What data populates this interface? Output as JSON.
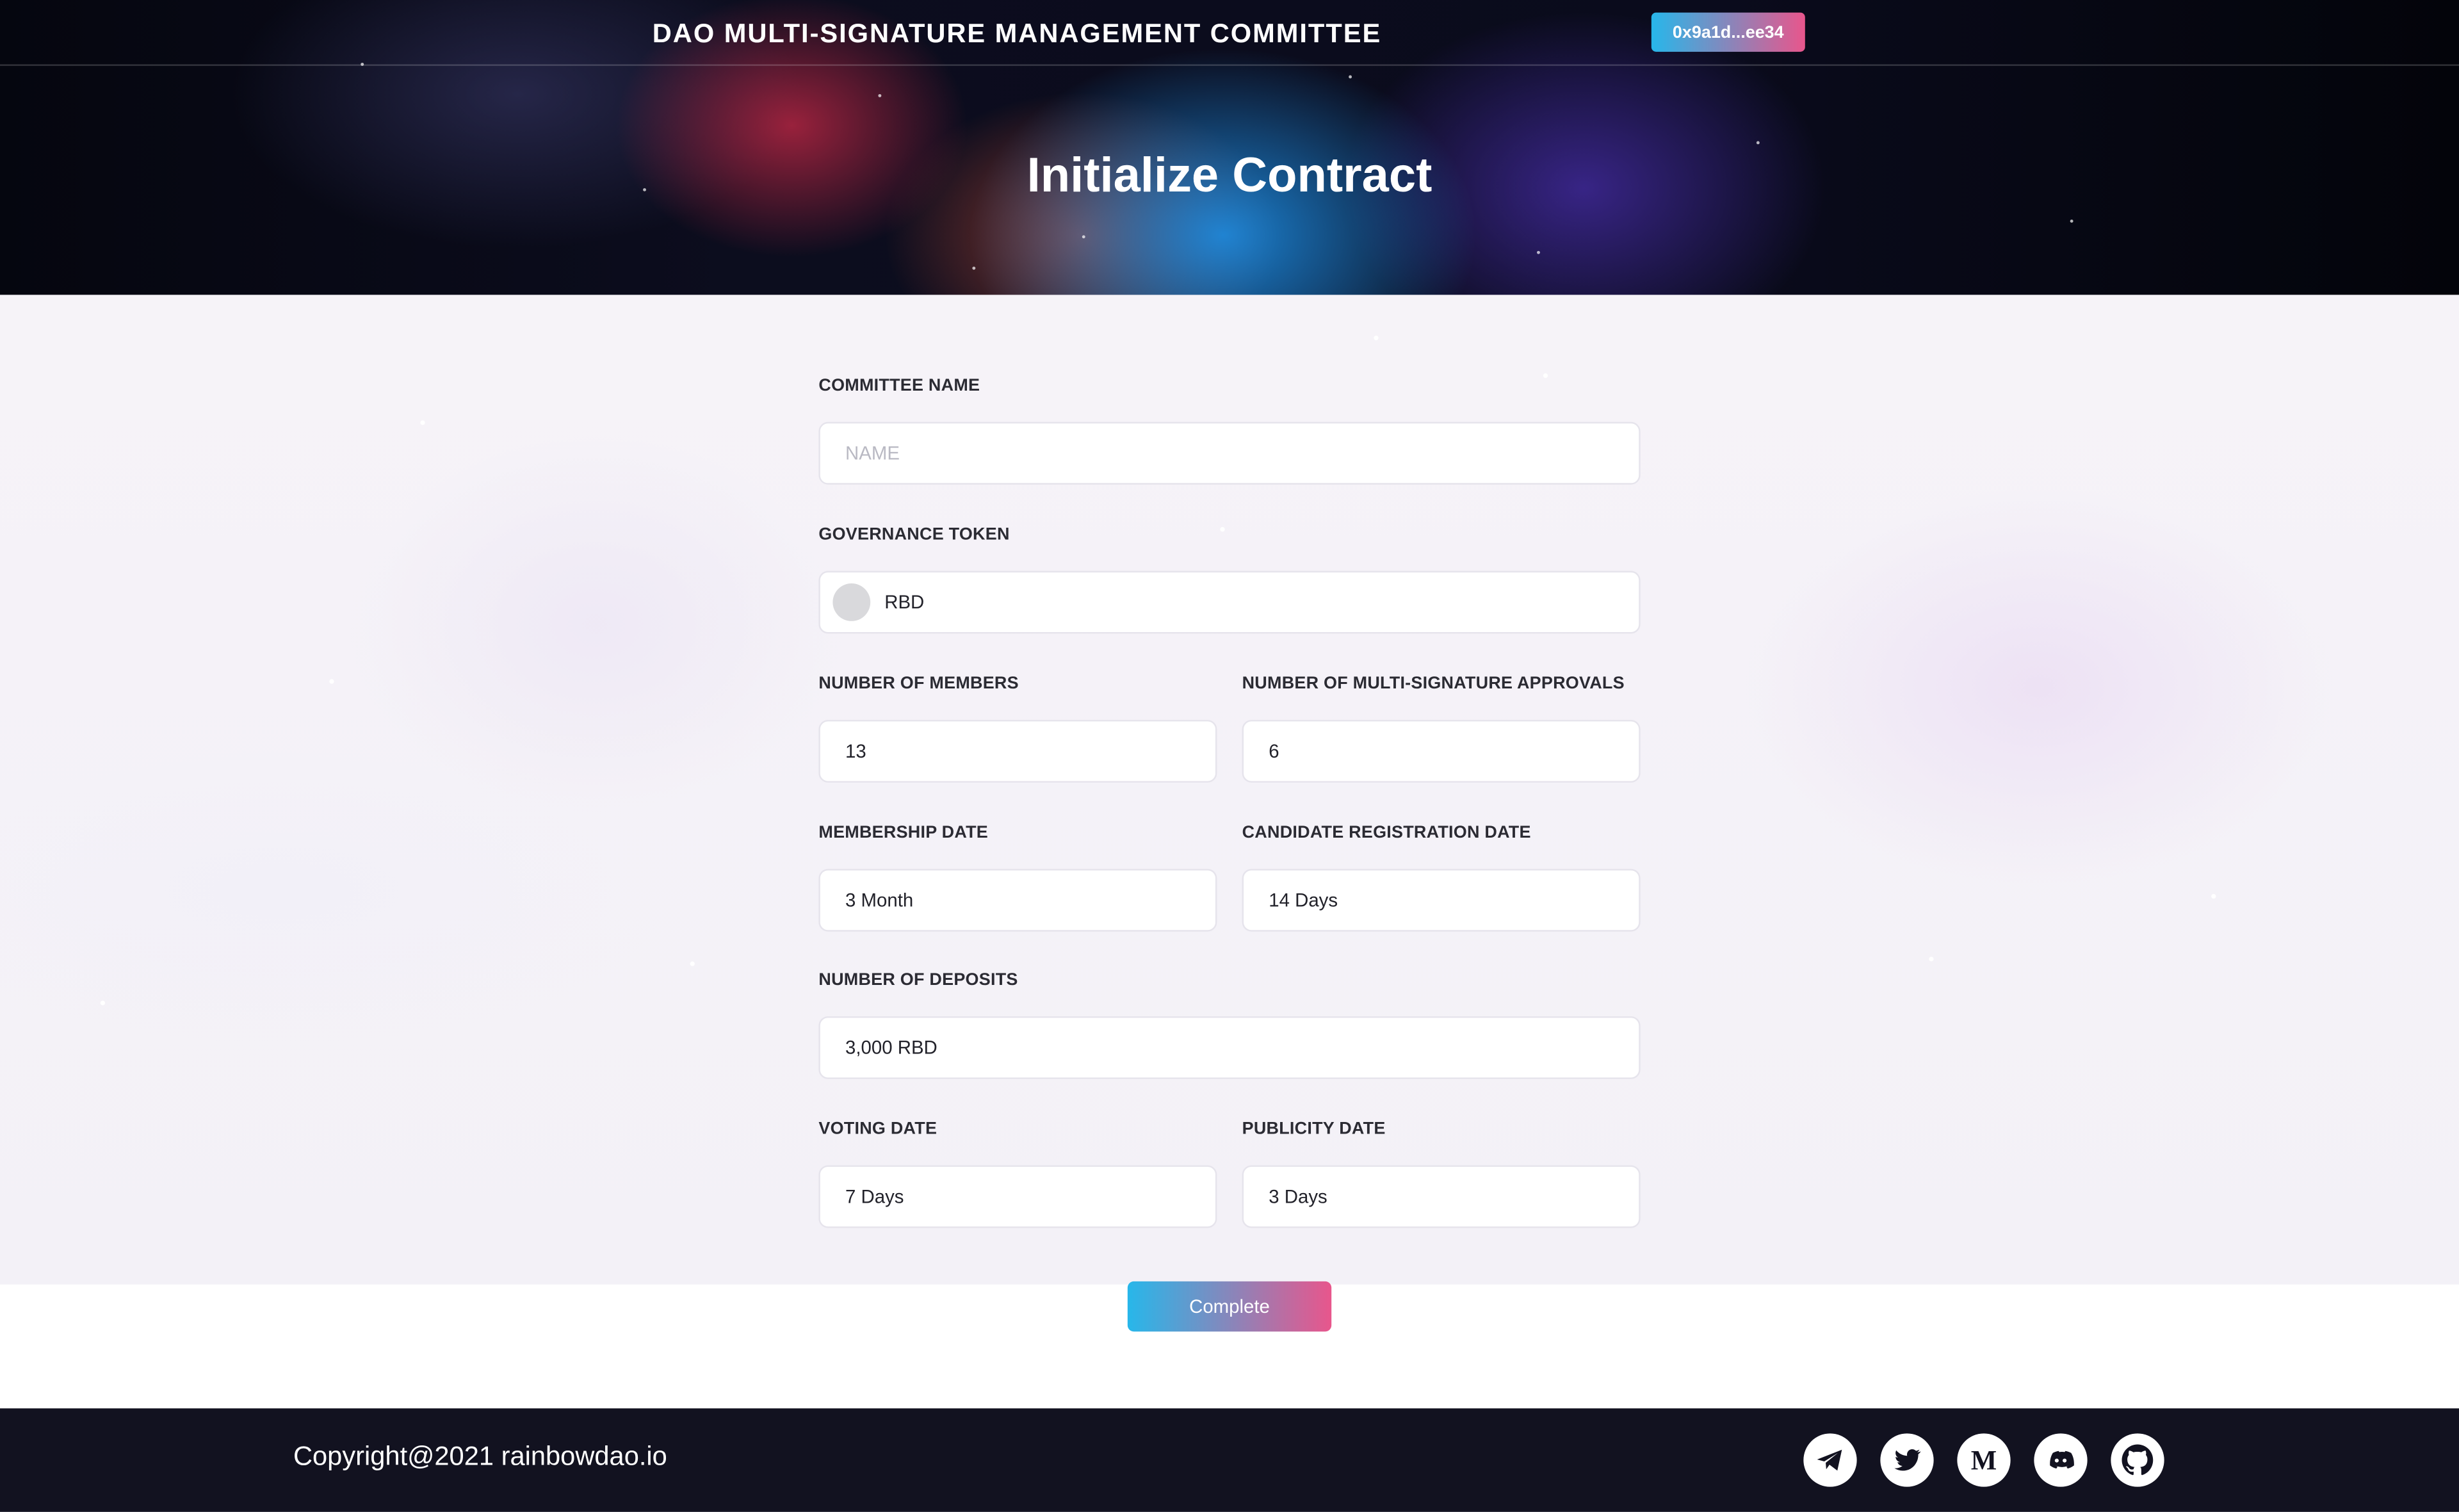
{
  "header": {
    "site_title": "DAO MULTI-SIGNATURE MANAGEMENT COMMITTEE",
    "wallet_address": "0x9a1d...ee34",
    "page_title": "Initialize Contract"
  },
  "form": {
    "committee_name": {
      "label": "COMMITTEE NAME",
      "value": "",
      "placeholder": "NAME"
    },
    "governance_token": {
      "label": "GOVERNANCE TOKEN",
      "value": "RBD"
    },
    "number_of_members": {
      "label": "NUMBER OF MEMBERS",
      "value": "13"
    },
    "multisig_approvals": {
      "label": "NUMBER OF MULTI-SIGNATURE APPROVALS",
      "value": "6"
    },
    "membership_date": {
      "label": "MEMBERSHIP DATE",
      "value": "3 Month"
    },
    "candidate_registration_date": {
      "label": "CANDIDATE REGISTRATION DATE",
      "value": "14 Days"
    },
    "number_of_deposits": {
      "label": "NUMBER OF DEPOSITS",
      "value": "3,000 RBD"
    },
    "voting_date": {
      "label": "VOTING DATE",
      "value": "7 Days"
    },
    "publicity_date": {
      "label": "PUBLICITY DATE",
      "value": "3 Days"
    },
    "complete_label": "Complete"
  },
  "footer": {
    "copyright": "Copyright@2021 rainbowdao.io",
    "social_icons": [
      "telegram-icon",
      "twitter-icon",
      "medium-icon",
      "discord-icon",
      "github-icon"
    ]
  },
  "colors": {
    "accent_start": "#27b7ea",
    "accent_end": "#e8568c",
    "footer_bg": "#121220"
  }
}
